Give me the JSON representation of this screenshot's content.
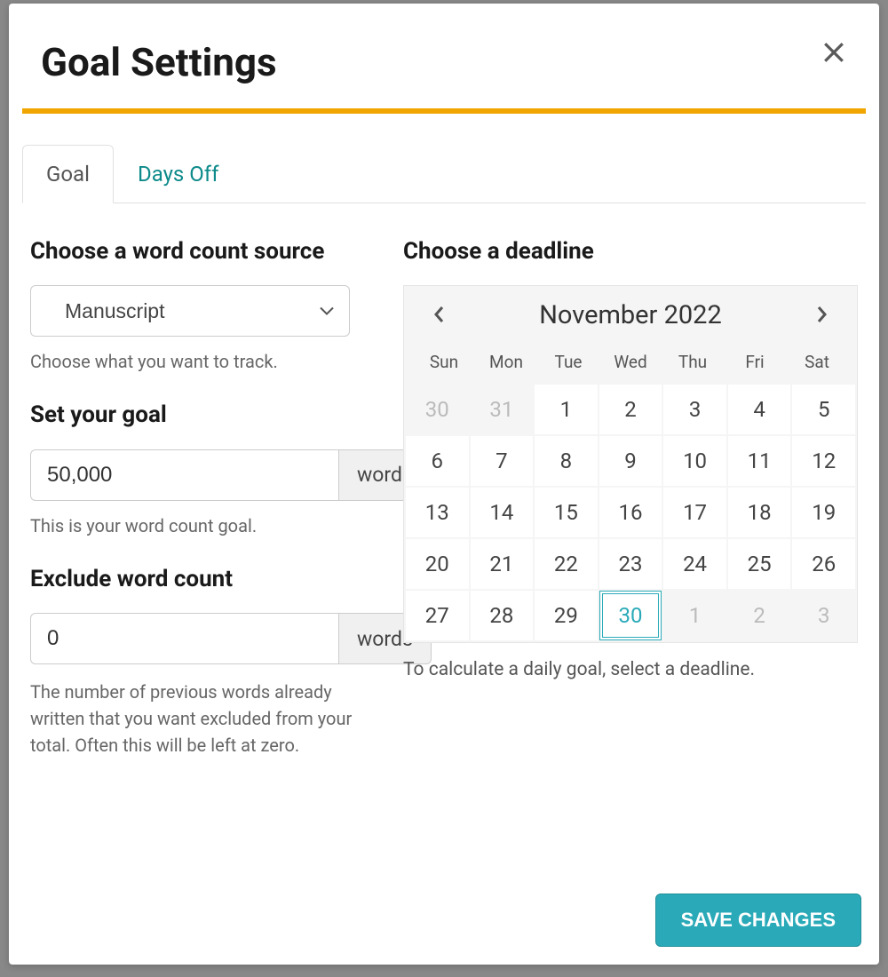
{
  "title": "Goal Settings",
  "tabs": [
    {
      "label": "Goal"
    },
    {
      "label": "Days Off"
    }
  ],
  "source": {
    "heading": "Choose a word count source",
    "selected": "Manuscript",
    "help": "Choose what you want to track."
  },
  "goal": {
    "heading": "Set your goal",
    "value": "50,000",
    "unit": "words",
    "help": "This is your word count goal."
  },
  "exclude": {
    "heading": "Exclude word count",
    "value": "0",
    "unit": "words",
    "help": "The number of previous words already written that you want excluded from your total. Often this will be left at zero."
  },
  "deadline": {
    "heading": "Choose a deadline",
    "month_label": "November 2022",
    "weekdays": [
      "Sun",
      "Mon",
      "Tue",
      "Wed",
      "Thu",
      "Fri",
      "Sat"
    ],
    "days": [
      {
        "d": "30",
        "other": true
      },
      {
        "d": "31",
        "other": true
      },
      {
        "d": "1"
      },
      {
        "d": "2"
      },
      {
        "d": "3"
      },
      {
        "d": "4"
      },
      {
        "d": "5"
      },
      {
        "d": "6"
      },
      {
        "d": "7"
      },
      {
        "d": "8"
      },
      {
        "d": "9"
      },
      {
        "d": "10"
      },
      {
        "d": "11"
      },
      {
        "d": "12"
      },
      {
        "d": "13"
      },
      {
        "d": "14"
      },
      {
        "d": "15"
      },
      {
        "d": "16"
      },
      {
        "d": "17"
      },
      {
        "d": "18"
      },
      {
        "d": "19"
      },
      {
        "d": "20"
      },
      {
        "d": "21"
      },
      {
        "d": "22"
      },
      {
        "d": "23"
      },
      {
        "d": "24"
      },
      {
        "d": "25"
      },
      {
        "d": "26"
      },
      {
        "d": "27"
      },
      {
        "d": "28"
      },
      {
        "d": "29"
      },
      {
        "d": "30",
        "selected": true
      },
      {
        "d": "1",
        "other": true
      },
      {
        "d": "2",
        "other": true
      },
      {
        "d": "3",
        "other": true
      }
    ],
    "help": "To calculate a daily goal, select a deadline."
  },
  "save_label": "SAVE CHANGES"
}
